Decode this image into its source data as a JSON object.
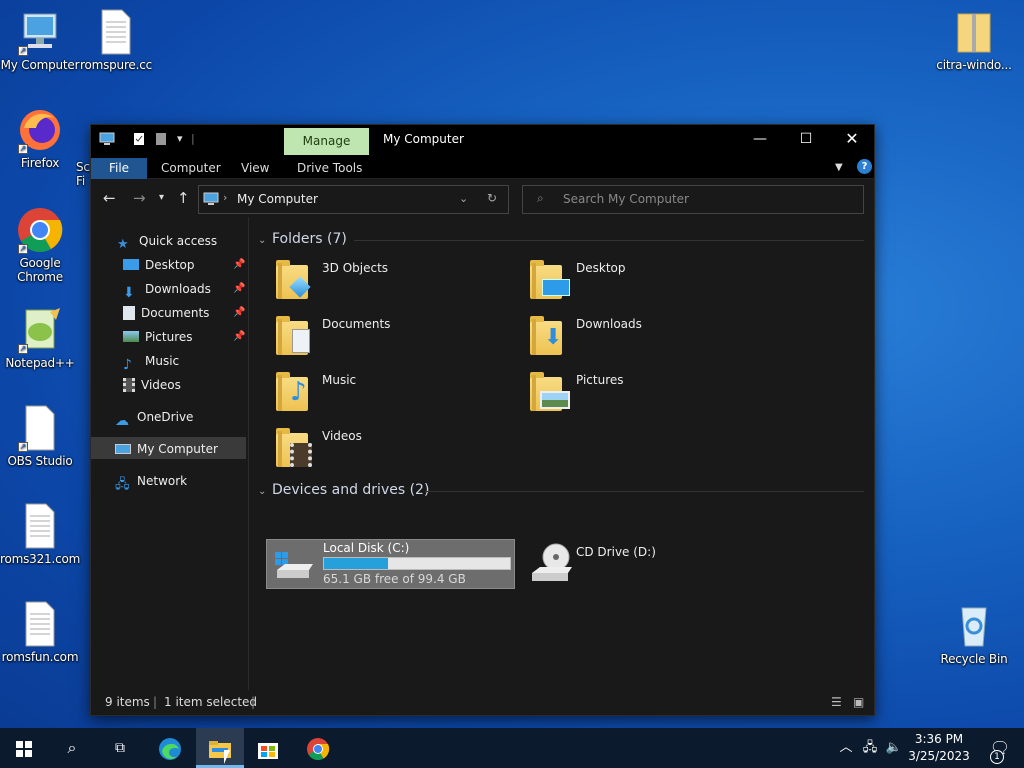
{
  "desktop": {
    "icons": [
      {
        "label": "My Computer",
        "icon": "computer-icon"
      },
      {
        "label": "romspure.cc",
        "icon": "text-file-icon"
      },
      {
        "label": "Firefox",
        "icon": "firefox-icon"
      },
      {
        "label": "Google Chrome",
        "icon": "chrome-icon"
      },
      {
        "label": "Notepad++",
        "icon": "notepadpp-icon"
      },
      {
        "label": "OBS Studio",
        "icon": "obs-icon"
      },
      {
        "label": "roms321.com",
        "icon": "text-file-icon"
      },
      {
        "label": "romsfun.com",
        "icon": "text-file-icon"
      },
      {
        "label": "citra-windo...",
        "icon": "zip-folder-icon"
      },
      {
        "label": "Recycle Bin",
        "icon": "recycle-bin-icon"
      },
      {
        "label": "Sc\nFi",
        "icon": "partial-icon"
      }
    ]
  },
  "window": {
    "title": "My Computer",
    "manage_tab": "Manage",
    "ribbon_tabs": [
      "File",
      "Computer",
      "View",
      "Drive Tools"
    ],
    "address": "My Computer",
    "search_placeholder": "Search My Computer",
    "nav": {
      "quick_access": "Quick access",
      "items": [
        "Desktop",
        "Downloads",
        "Documents",
        "Pictures",
        "Music",
        "Videos"
      ],
      "onedrive": "OneDrive",
      "my_computer": "My Computer",
      "network": "Network"
    },
    "folders_header": "Folders (7)",
    "folders": [
      "3D Objects",
      "Desktop",
      "Documents",
      "Downloads",
      "Music",
      "Pictures",
      "Videos"
    ],
    "devices_header": "Devices and drives (2)",
    "drives": [
      {
        "name": "Local Disk (C:)",
        "free": "65.1 GB free of 99.4 GB",
        "used_fraction": 0.345
      },
      {
        "name": "CD Drive (D:)"
      }
    ],
    "status": {
      "items": "9 items",
      "selected": "1 item selected"
    }
  },
  "taskbar": {
    "time": "3:36 PM",
    "date": "3/25/2023",
    "notification_count": "1"
  },
  "colors": {
    "accent": "#1f5591",
    "manage": "#bfe6b0",
    "drive_bar": "#26a0da"
  }
}
